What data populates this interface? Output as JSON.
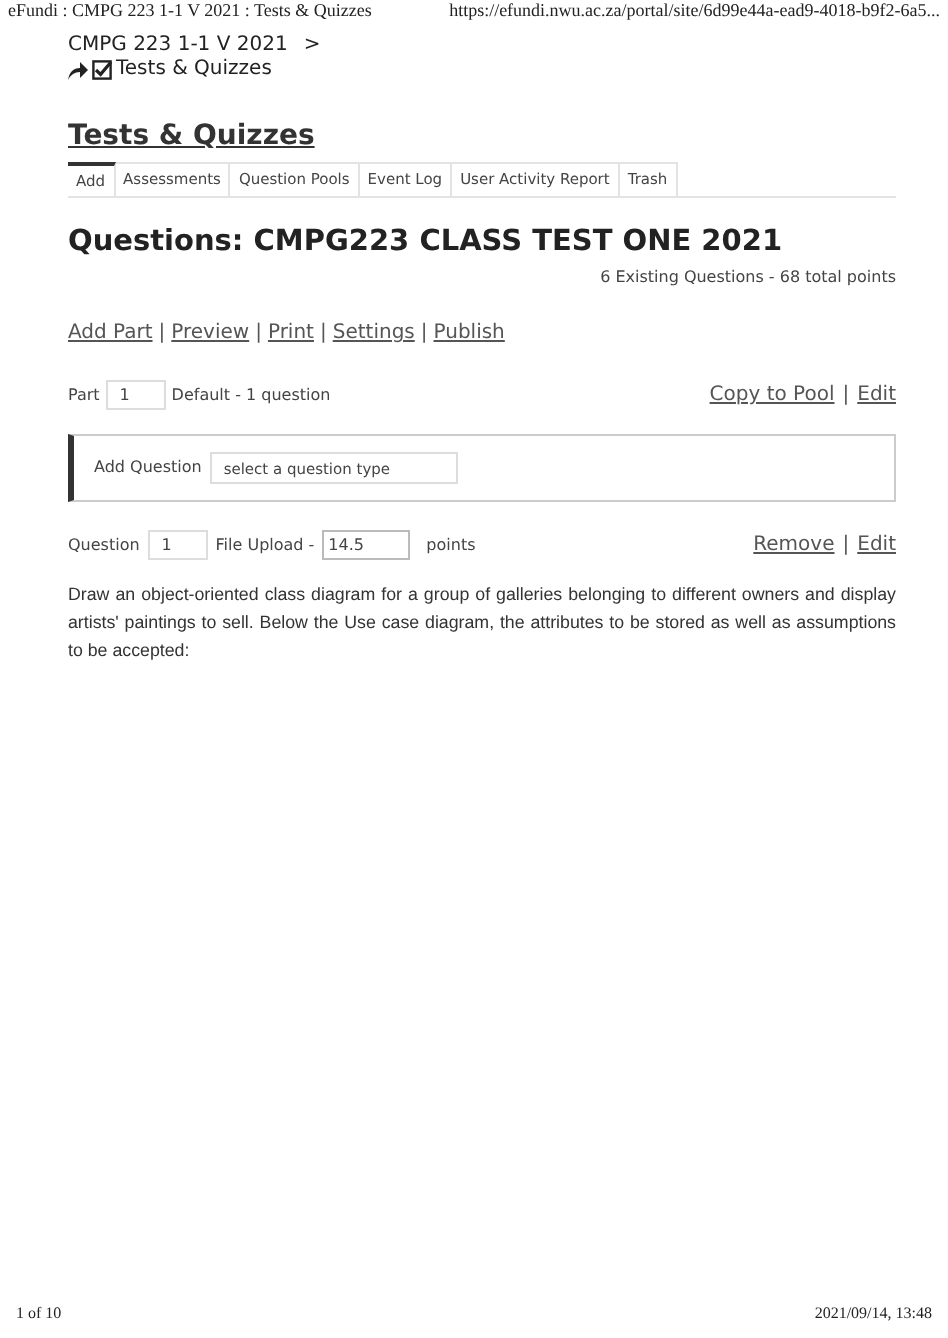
{
  "print_header": {
    "page_title": "eFundi : CMPG 223 1-1 V 2021 : Tests & Quizzes",
    "url": "https://efundi.nwu.ac.za/portal/site/6d99e44a-ead9-4018-b9f2-6a5..."
  },
  "breadcrumb": {
    "site": "CMPG 223 1-1 V 2021",
    "separator": ">",
    "tool": "Tests & Quizzes"
  },
  "tool_title": "Tests & Quizzes",
  "tabs": [
    {
      "label": "Add",
      "selected": true
    },
    {
      "label": "Assessments",
      "selected": false
    },
    {
      "label": "Question Pools",
      "selected": false
    },
    {
      "label": "Event Log",
      "selected": false
    },
    {
      "label": "User Activity Report",
      "selected": false
    },
    {
      "label": "Trash",
      "selected": false
    }
  ],
  "heading": "Questions: CMPG223 CLASS TEST ONE 2021",
  "summary": "6 Existing Questions - 68 total points",
  "link_separator": "|",
  "actions": [
    "Add Part",
    "Preview",
    "Print",
    "Settings",
    "Publish"
  ],
  "part": {
    "label": "Part",
    "number": "1",
    "description": "Default - 1 question",
    "links": [
      "Copy to Pool",
      "Edit"
    ]
  },
  "add_question": {
    "label": "Add Question",
    "placeholder": "select a question type"
  },
  "question": {
    "label": "Question",
    "number": "1",
    "type": "File Upload -",
    "points": "14.5",
    "points_label": "points",
    "links": [
      "Remove",
      "Edit"
    ],
    "text": "Draw an object-oriented class diagram for a group of galleries belonging to different owners and display artists' paintings to sell. Below the Use case diagram, the attributes to be stored as well as assumptions to be accepted:"
  },
  "print_footer": {
    "page": "1 of 10",
    "timestamp": "2021/09/14, 13:48"
  }
}
